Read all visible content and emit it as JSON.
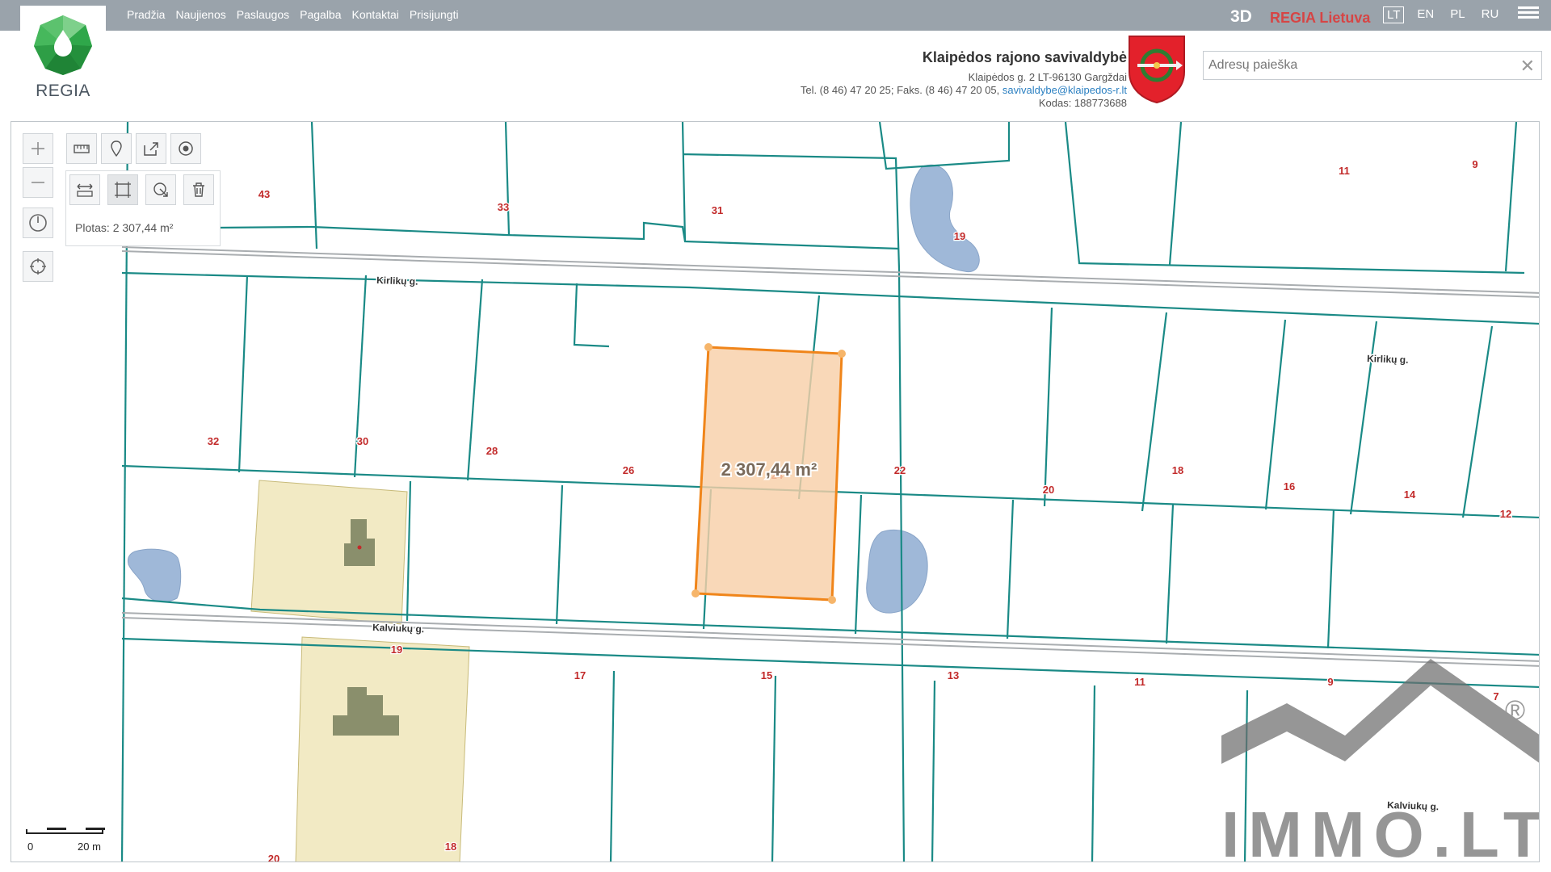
{
  "brand": {
    "logo_text": "REGIA"
  },
  "nav": [
    "Pradžia",
    "Naujienos",
    "Paslaugos",
    "Pagalba",
    "Kontaktai",
    "Prisijungti"
  ],
  "header_right": {
    "btn_3d": "3D",
    "regia_lietuva": "REGIA Lietuva",
    "languages": [
      "LT",
      "EN",
      "PL",
      "RU"
    ],
    "active_language": "LT"
  },
  "municipality": {
    "title": "Klaipėdos rajono savivaldybė",
    "address": "Klaipėdos g. 2 LT-96130 Gargždai",
    "phone": "Tel. (8 46) 47 20 25; Faks. (8 46) 47 20 05, ",
    "email": "savivaldybe@klaipedos-r.lt",
    "code": "Kodas: 188773688"
  },
  "search": {
    "placeholder": "Adresų paieška",
    "value": ""
  },
  "measure": {
    "area_label": "Plotas: 2 307,44 m²",
    "map_area_label": "2 307,44 m²"
  },
  "streets": [
    "Kirlikų g.",
    "Kirlikų g.",
    "Kalviukų g.",
    "Kalviukų g."
  ],
  "parcel_numbers": [
    "43",
    "33",
    "31",
    "19",
    "11",
    "9",
    "32",
    "30",
    "28",
    "26",
    "24",
    "22",
    "20",
    "18",
    "16",
    "14",
    "12",
    "19",
    "17",
    "15",
    "13",
    "11",
    "9",
    "7",
    "20",
    "18"
  ],
  "scale": {
    "left": "0",
    "right": "20 m"
  },
  "watermark": {
    "text": "IMMO.LT",
    "mark": "®"
  },
  "colors": {
    "topbar": "#9aa3ab",
    "parcel_line": "#1a8a86",
    "highlight_fill": "#f8cfa8",
    "highlight_stroke": "#f0851a",
    "water": "#9fb8d8",
    "building_zone": "#f2eac4",
    "building": "#8a8f6c",
    "label": "#c22a2a"
  }
}
